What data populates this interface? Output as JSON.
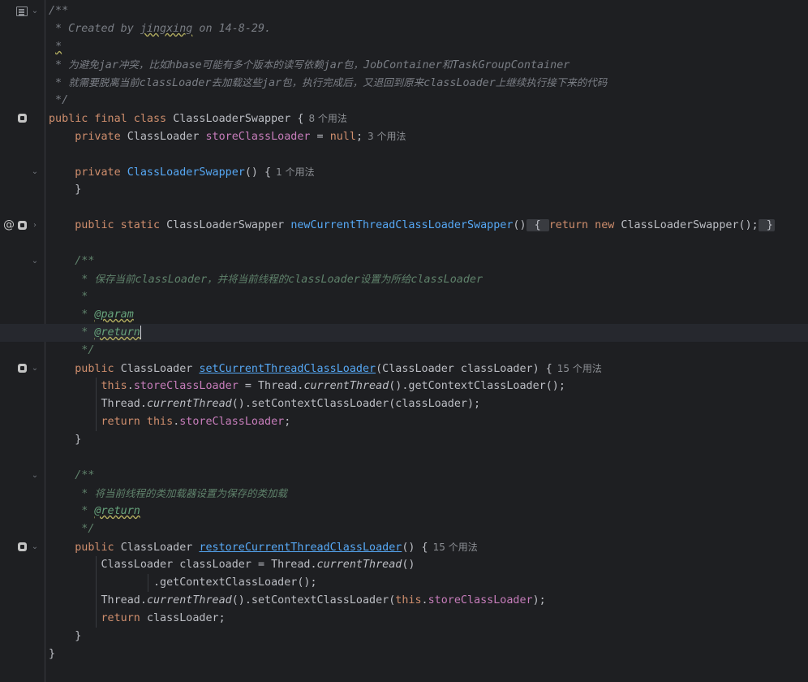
{
  "editor": {
    "lines": [
      {
        "text": "/**"
      },
      {
        "text": " * Created by jingxing on 14-8-29."
      },
      {
        "text": " *"
      },
      {
        "text": " * 为避免jar冲突，比如hbase可能有多个版本的读写依赖jar包，JobContainer和TaskGroupContainer"
      },
      {
        "text": " * 就需要脱离当前classLoader去加载这些jar包，执行完成后，又退回到原来classLoader上继续执行接下来的代码"
      },
      {
        "text": " */"
      },
      {
        "text": "public final class ClassLoaderSwapper {"
      },
      {
        "text": "private ClassLoader storeClassLoader = null;"
      },
      {
        "text": ""
      },
      {
        "text": "private ClassLoaderSwapper() {"
      },
      {
        "text": "}"
      },
      {
        "text": ""
      },
      {
        "text": "public static ClassLoaderSwapper newCurrentThreadClassLoaderSwapper() { return new ClassLoaderSwapper(); }"
      },
      {
        "text": ""
      },
      {
        "text": "/**"
      },
      {
        "text": " * 保存当前classLoader，并将当前线程的classLoader设置为所给classLoader"
      },
      {
        "text": " *"
      },
      {
        "text": " * @param"
      },
      {
        "text": " * @return"
      },
      {
        "text": " */"
      },
      {
        "text": "public ClassLoader setCurrentThreadClassLoader(ClassLoader classLoader) {"
      },
      {
        "text": "this.storeClassLoader = Thread.currentThread().getContextClassLoader();"
      },
      {
        "text": "Thread.currentThread().setContextClassLoader(classLoader);"
      },
      {
        "text": "return this.storeClassLoader;"
      },
      {
        "text": "}"
      },
      {
        "text": ""
      },
      {
        "text": "/**"
      },
      {
        "text": " * 将当前线程的类加载器设置为保存的类加载"
      },
      {
        "text": " * @return"
      },
      {
        "text": " */"
      },
      {
        "text": "public ClassLoader restoreCurrentThreadClassLoader() {"
      },
      {
        "text": "ClassLoader classLoader = Thread.currentThread()"
      },
      {
        "text": ".getContextClassLoader();"
      },
      {
        "text": "Thread.currentThread().setContextClassLoader(this.storeClassLoader);"
      },
      {
        "text": "return classLoader;"
      },
      {
        "text": "}"
      },
      {
        "text": "}"
      }
    ],
    "hints": {
      "class_usages": "8 个用法",
      "field_usages": "3 个用法",
      "ctor_usages": "1 个用法",
      "set_usages": "15 个用法",
      "restore_usages": "15 个用法"
    },
    "colors": {
      "background": "#1e1f22",
      "keyword": "#cf8e6d",
      "comment": "#7a7e85",
      "doc_comment": "#5f826b",
      "method_declaration": "#56a8f5",
      "field": "#c77dbb",
      "text": "#bcbec4"
    },
    "gutter_icons": [
      "reader-mode-icon",
      "implemented-icon",
      "annotation-icon",
      "fold-chevron-icon"
    ]
  }
}
